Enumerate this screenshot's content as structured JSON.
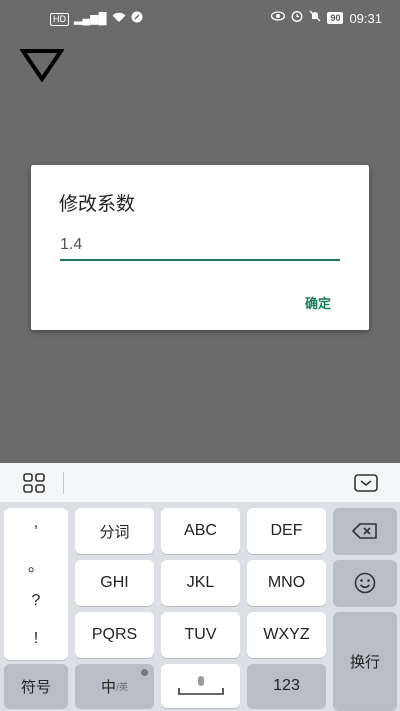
{
  "status_bar": {
    "left_icons": [
      "HD",
      "5G",
      "signal",
      "wifi",
      "notification"
    ],
    "battery": "90",
    "time": "09:31"
  },
  "dialog": {
    "title": "修改系数",
    "input_value": "1.4",
    "confirm_label": "确定"
  },
  "keyboard": {
    "punctuation": [
      ",",
      "。",
      "?",
      "!"
    ],
    "rows": [
      [
        "分词",
        "ABC",
        "DEF"
      ],
      [
        "GHI",
        "JKL",
        "MNO"
      ],
      [
        "PQRS",
        "TUV",
        "WXYZ"
      ]
    ],
    "symbols_label": "符号",
    "lang_label": "中",
    "lang_sub": "/英",
    "numbers_label": "123",
    "enter_label": "换行",
    "accent_color": "#1a7a5a"
  }
}
